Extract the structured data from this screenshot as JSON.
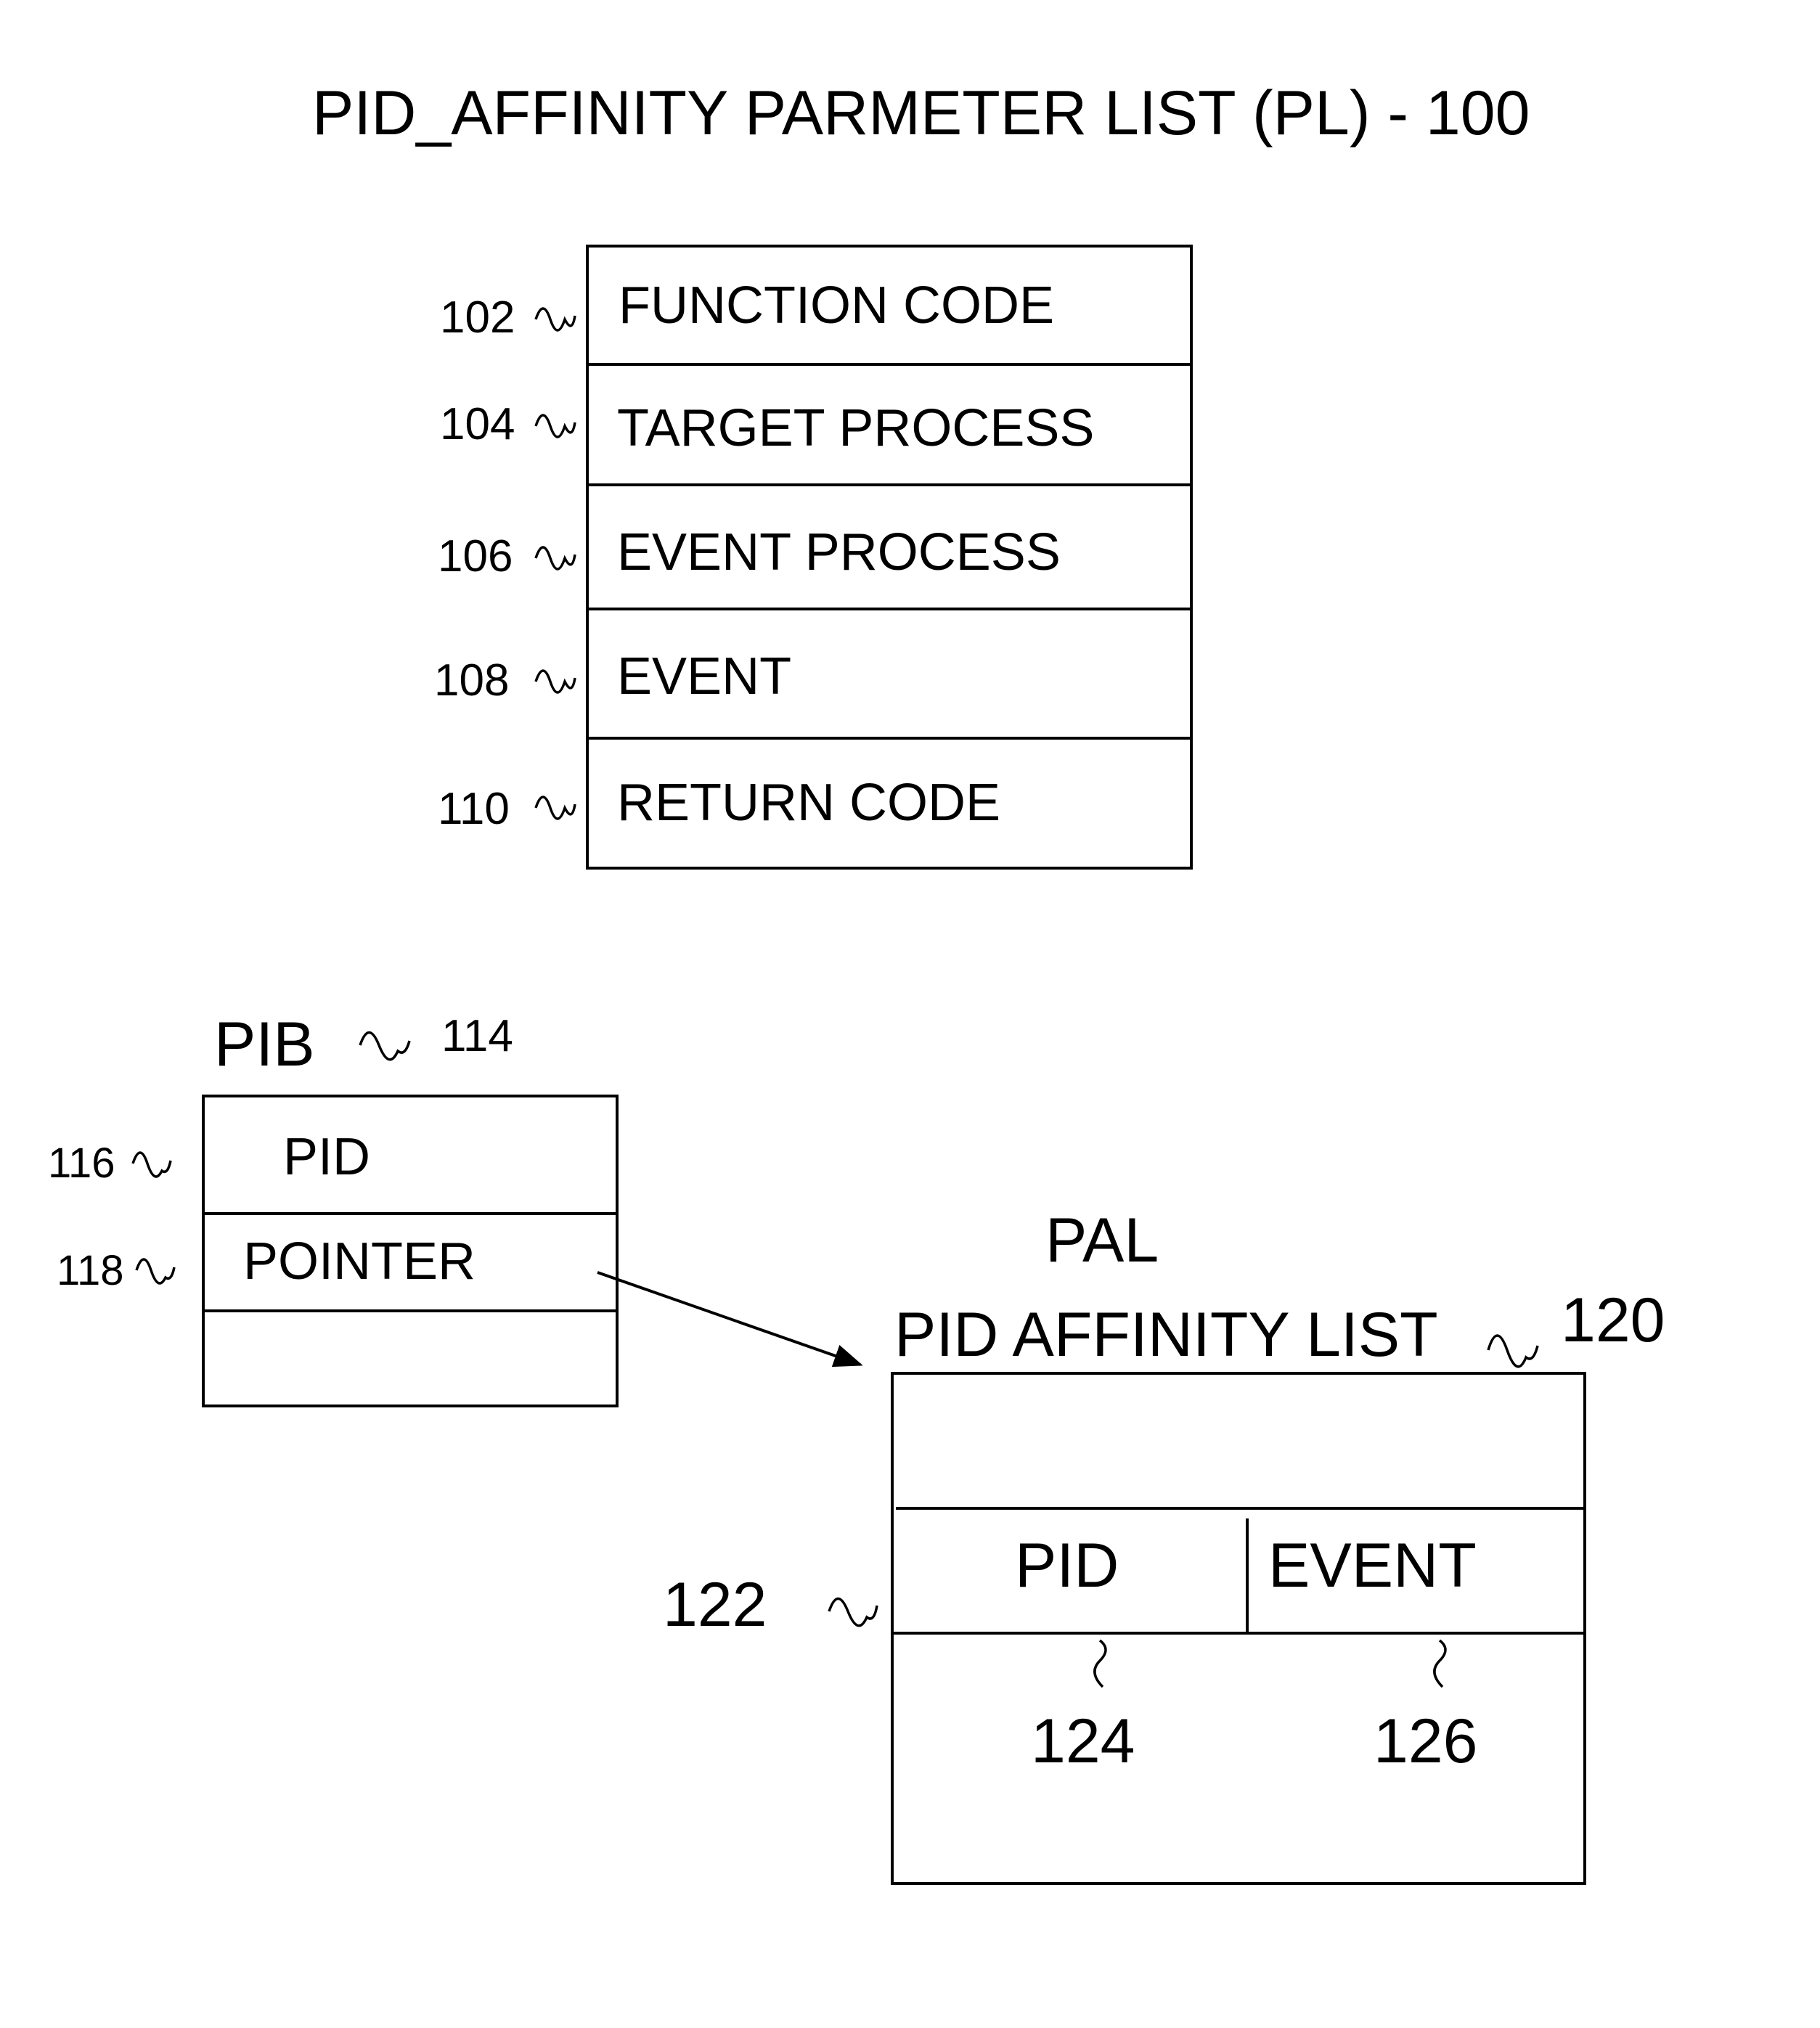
{
  "title": "PID_AFFINITY PARMETER LIST (PL) - 100",
  "parameter_list": {
    "ref": "100",
    "rows": [
      {
        "ref": "102",
        "label": "FUNCTION CODE"
      },
      {
        "ref": "104",
        "label": "TARGET PROCESS"
      },
      {
        "ref": "106",
        "label": "EVENT PROCESS"
      },
      {
        "ref": "108",
        "label": "EVENT"
      },
      {
        "ref": "110",
        "label": "RETURN CODE"
      }
    ]
  },
  "pib": {
    "title": "PIB",
    "ref": "114",
    "rows": [
      {
        "ref": "116",
        "label": "PID"
      },
      {
        "ref": "118",
        "label": "POINTER"
      },
      {
        "ref": "",
        "label": ""
      }
    ]
  },
  "pal": {
    "title_line1": "PAL",
    "title_line2": "PID AFFINITY LIST",
    "ref": "120",
    "entry_ref": "122",
    "columns": [
      {
        "label": "PID",
        "ref": "124"
      },
      {
        "label": "EVENT",
        "ref": "126"
      }
    ]
  }
}
